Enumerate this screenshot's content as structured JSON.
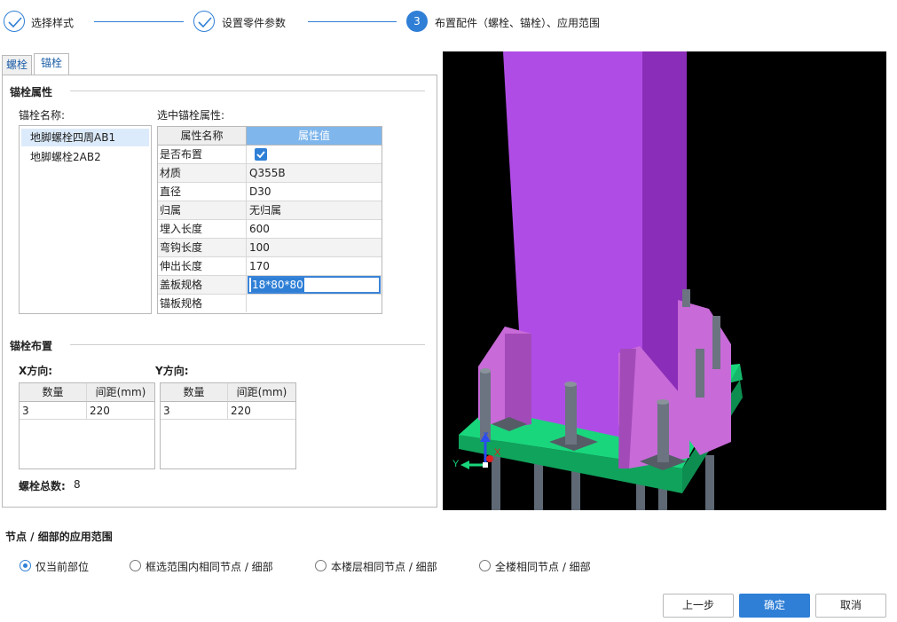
{
  "steps": [
    {
      "label": "选择样式",
      "state": "done"
    },
    {
      "label": "设置零件参数",
      "state": "done"
    },
    {
      "number": "3",
      "label": "布置配件（螺栓、锚栓）、应用范围",
      "state": "current"
    }
  ],
  "tabs": [
    {
      "label": "螺栓",
      "active": false
    },
    {
      "label": "锚栓",
      "active": true
    }
  ],
  "anchor_props": {
    "section_title": "锚栓属性",
    "name_label": "锚栓名称:",
    "names": [
      "地脚螺栓四周AB1",
      "地脚螺栓2AB2"
    ],
    "selected_index": 0,
    "props_label": "选中锚栓属性:",
    "grid_header": {
      "name": "属性名称",
      "value": "属性值"
    },
    "rows": [
      {
        "name": "是否布置",
        "value": "",
        "checkbox": true
      },
      {
        "name": "材质",
        "value": "Q355B"
      },
      {
        "name": "直径",
        "value": "D30"
      },
      {
        "name": "归属",
        "value": "无归属"
      },
      {
        "name": "埋入长度",
        "value": "600"
      },
      {
        "name": "弯钩长度",
        "value": "100"
      },
      {
        "name": "伸出长度",
        "value": "170"
      },
      {
        "name": "盖板规格",
        "value": "18*80*80",
        "editing": true
      },
      {
        "name": "锚板规格",
        "value": ""
      }
    ]
  },
  "layout_section": {
    "title": "锚栓布置",
    "x_label": "X方向:",
    "y_label": "Y方向:",
    "x_table": {
      "headers": [
        "数量",
        "间距(mm)"
      ],
      "rows": [
        [
          "3",
          "220"
        ]
      ]
    },
    "y_table": {
      "headers": [
        "数量",
        "间距(mm)"
      ],
      "rows": [
        [
          "3",
          "220"
        ]
      ]
    },
    "total_label": "螺栓总数:",
    "total_value": "8"
  },
  "view3d": {
    "axis_labels": {
      "z": "Z",
      "y": "Y",
      "x": "X"
    },
    "colors": {
      "column": "#b04ce6",
      "plate": "#19d67c",
      "stiffener": "#c86ad8",
      "bolt": "#6b7480",
      "background": "#000000"
    }
  },
  "scope": {
    "title": "节点 / 细部的应用范围",
    "options": [
      "仅当前部位",
      "框选范围内相同节点 / 细部",
      "本楼层相同节点 / 细部",
      "全楼相同节点 / 细部"
    ],
    "selected_index": 0
  },
  "buttons": {
    "prev": "上一步",
    "ok": "确定",
    "cancel": "取消"
  }
}
